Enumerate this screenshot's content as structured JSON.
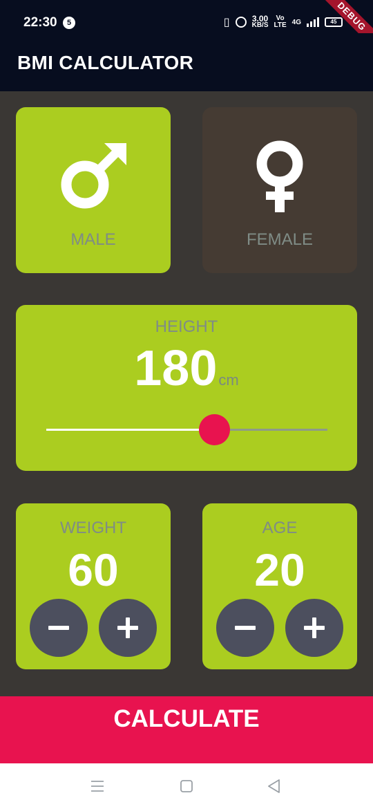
{
  "status_bar": {
    "time": "22:30",
    "notification_count": "5",
    "net_speed": "3.00",
    "net_speed_unit": "KB/S",
    "volte_top": "Vo",
    "volte_bottom": "LTE",
    "network": "4G",
    "battery": "45",
    "debug_banner": "DEBUG"
  },
  "app_bar": {
    "title": "BMI CALCULATOR"
  },
  "gender": {
    "male_label": "MALE",
    "female_label": "FEMALE",
    "selected": "male"
  },
  "height": {
    "label": "HEIGHT",
    "value": "180",
    "unit": "cm",
    "slider_fraction": 0.6
  },
  "weight": {
    "label": "WEIGHT",
    "value": "60"
  },
  "age": {
    "label": "AGE",
    "value": "20"
  },
  "calculate_label": "CALCULATE",
  "colors": {
    "active_card": "#abcd20",
    "inactive_card": "#453b33",
    "accent": "#e8134f",
    "background": "#3a3734",
    "app_bar": "#070d1f",
    "round_button": "#4c4f5e"
  },
  "nav_icons": [
    "menu-icon",
    "home-square-icon",
    "back-triangle-icon"
  ]
}
